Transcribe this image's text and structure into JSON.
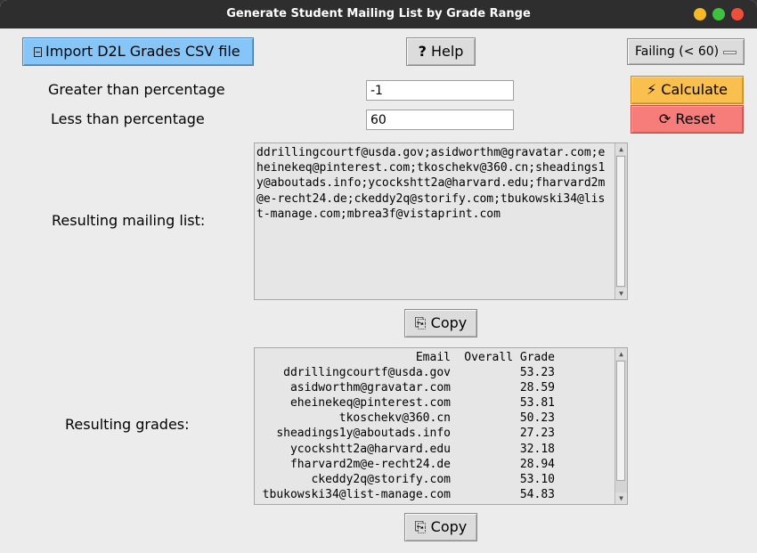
{
  "window": {
    "title": "Generate Student Mailing List by Grade Range"
  },
  "toolbar": {
    "import_label": "Import D2L Grades CSV file",
    "import_icon": "file-open-icon",
    "help_label": "Help",
    "help_glyph": "?",
    "range_select": "Failing (< 60)"
  },
  "filters": {
    "greater_label": "Greater than percentage",
    "greater_value": "-1",
    "less_label": "Less than percentage",
    "less_value": "60"
  },
  "actions": {
    "calculate_label": "Calculate",
    "calculate_glyph": "⚡",
    "reset_label": "Reset",
    "reset_glyph": "⟳",
    "calculate_color": "#f9bf4f",
    "reset_color": "#f67d79"
  },
  "mailing": {
    "label": "Resulting mailing list:",
    "lines": [
      "ddrillingcourtf@usda.gov;asidworthm@gravatar.com;e",
      "heinekeq@pinterest.com;tkoschekv@360.cn;sheadings1",
      "y@aboutads.info;ycockshtt2a@harvard.edu;fharvard2m",
      "@e-recht24.de;ckeddy2q@storify.com;tbukowski34@lis",
      "t-manage.com;mbrea3f@vistaprint.com"
    ],
    "copy_label": "Copy",
    "copy_glyph": "⎘"
  },
  "grades": {
    "label": "Resulting grades:",
    "col_email": "Email",
    "col_grade": "Overall Grade",
    "rows": [
      {
        "email": "ddrillingcourtf@usda.gov",
        "grade": "53.23"
      },
      {
        "email": "asidworthm@gravatar.com",
        "grade": "28.59"
      },
      {
        "email": "eheinekeq@pinterest.com",
        "grade": "53.81"
      },
      {
        "email": "tkoschekv@360.cn",
        "grade": "50.23"
      },
      {
        "email": "sheadings1y@aboutads.info",
        "grade": "27.23"
      },
      {
        "email": "ycockshtt2a@harvard.edu",
        "grade": "32.18"
      },
      {
        "email": "fharvard2m@e-recht24.de",
        "grade": "28.94"
      },
      {
        "email": "ckeddy2q@storify.com",
        "grade": "53.10"
      },
      {
        "email": "tbukowski34@list-manage.com",
        "grade": "54.83"
      }
    ],
    "copy_label": "Copy",
    "copy_glyph": "⎘"
  }
}
